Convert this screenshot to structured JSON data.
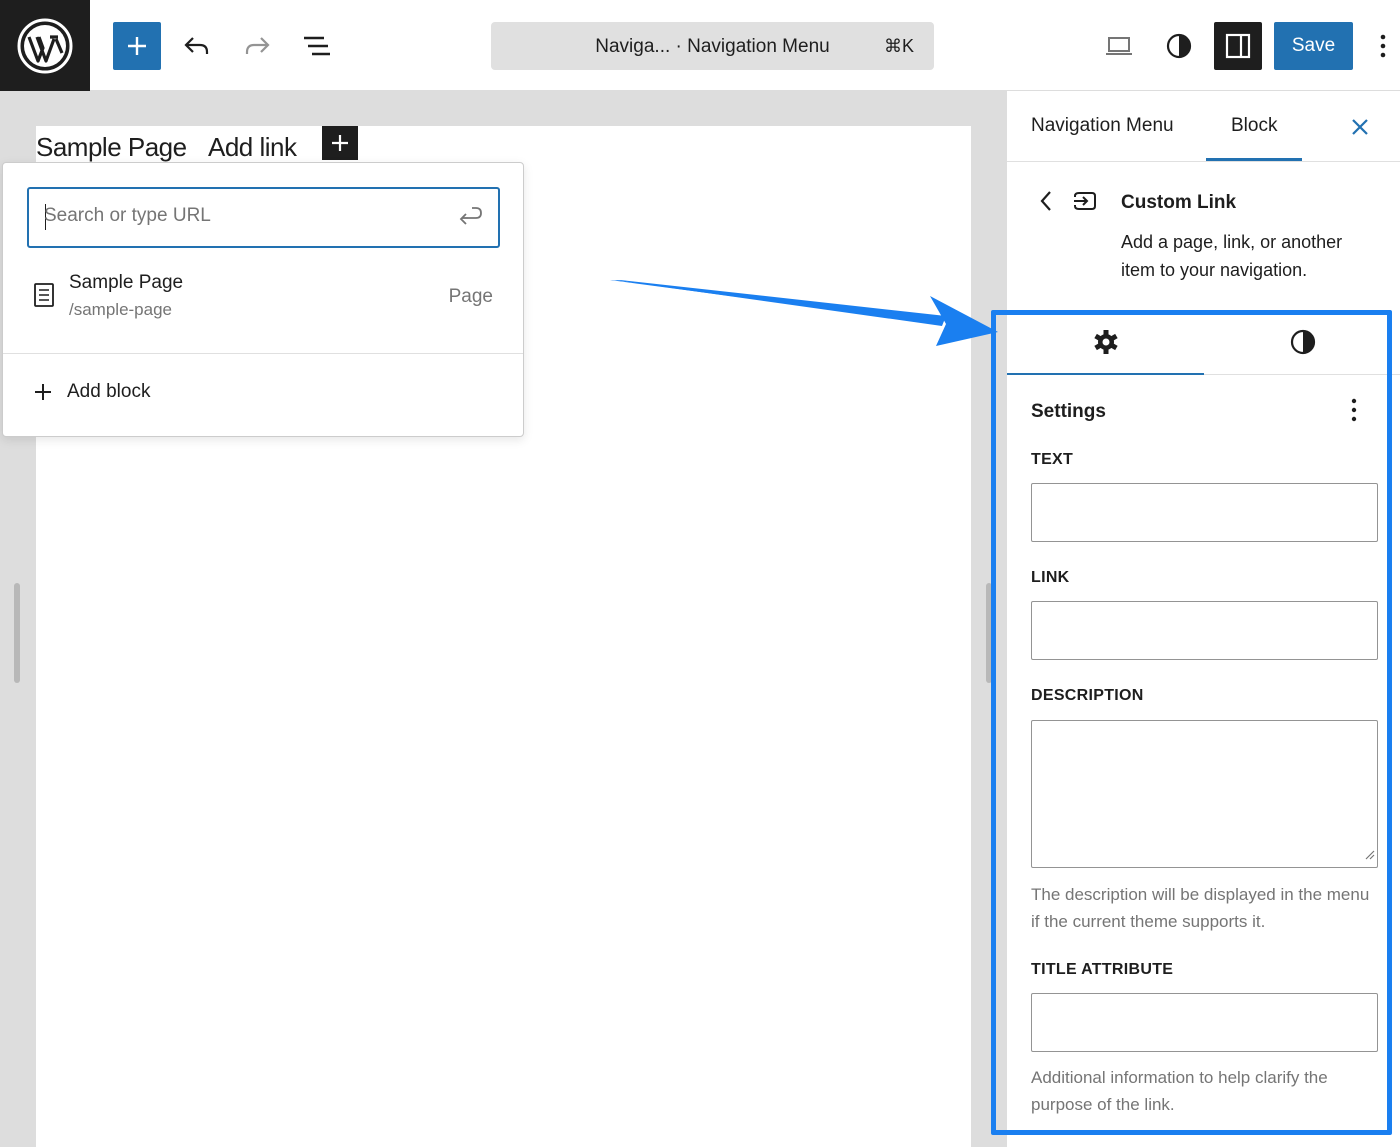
{
  "toolbar": {
    "document_title": "Naviga...  · Navigation Menu",
    "shortcut": "⌘K",
    "save_label": "Save"
  },
  "canvas": {
    "nav_items": [
      "Sample Page",
      "Add link"
    ]
  },
  "link_popover": {
    "search_placeholder": "Search or type URL",
    "suggestion": {
      "title": "Sample Page",
      "url": "/sample-page",
      "type": "Page"
    },
    "add_block_label": "Add block"
  },
  "sidebar": {
    "tabs": [
      {
        "label": "Navigation Menu",
        "active": false
      },
      {
        "label": "Block",
        "active": true
      }
    ],
    "block_card": {
      "title": "Custom Link",
      "description": "Add a page, link, or another item to your navigation."
    },
    "settings_title": "Settings",
    "fields": {
      "text_label": "TEXT",
      "link_label": "LINK",
      "description_label": "DESCRIPTION",
      "description_help": "The description will be displayed in the menu if the current theme supports it.",
      "title_attr_label": "TITLE ATTRIBUTE",
      "title_attr_help": "Additional information to help clarify the purpose of the link."
    }
  },
  "colors": {
    "accent": "#2271b1",
    "annotation": "#1a7ff0",
    "dark": "#1e1e1e"
  }
}
